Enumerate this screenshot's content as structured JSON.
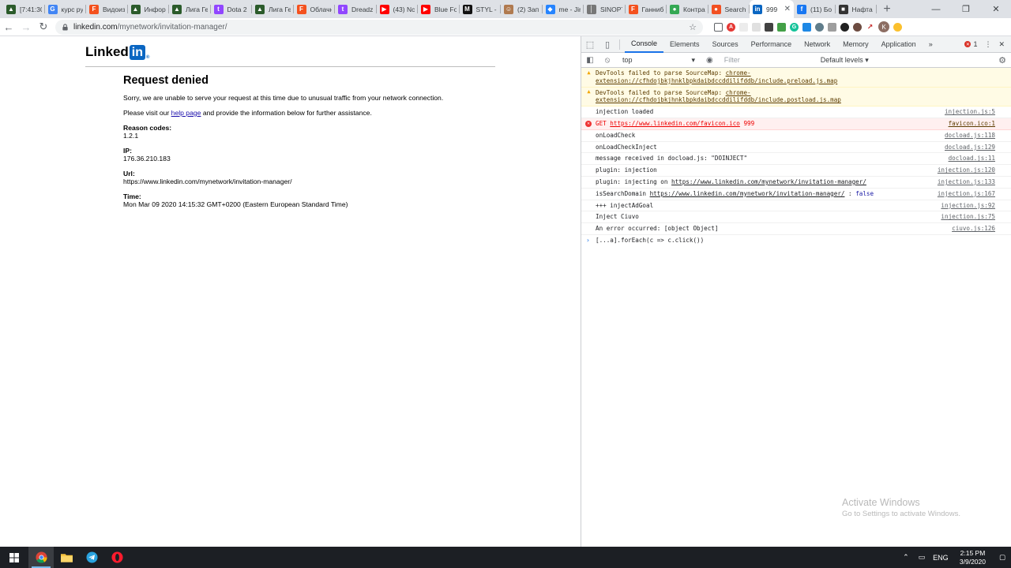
{
  "browser": {
    "tabs": [
      {
        "title": "[7:41:30",
        "color": "#2b5b2b",
        "glyph": "▲"
      },
      {
        "title": "курс руб",
        "color": "#4285f4",
        "glyph": "G"
      },
      {
        "title": "Видоиз",
        "color": "#f4511e",
        "glyph": "F"
      },
      {
        "title": "Инфор",
        "color": "#2b5b2b",
        "glyph": "▲"
      },
      {
        "title": "Лига Ге",
        "color": "#2b5b2b",
        "glyph": "▲"
      },
      {
        "title": "Dota 2",
        "color": "#9146ff",
        "glyph": "t"
      },
      {
        "title": "Лига Ге",
        "color": "#2b5b2b",
        "glyph": "▲"
      },
      {
        "title": "Облачн",
        "color": "#f4511e",
        "glyph": "F"
      },
      {
        "title": "Dreadz",
        "color": "#9146ff",
        "glyph": "t"
      },
      {
        "title": "(43) Nc",
        "color": "#ff0000",
        "glyph": "▶"
      },
      {
        "title": "Blue Fo",
        "color": "#ff0000",
        "glyph": "▶"
      },
      {
        "title": "STYL -",
        "color": "#111111",
        "glyph": "M"
      },
      {
        "title": "(2) Зап",
        "color": "#b07a4f",
        "glyph": "☺"
      },
      {
        "title": "me - Jir",
        "color": "#2684ff",
        "glyph": "◆"
      },
      {
        "title": "SINOPT",
        "color": "#777777",
        "glyph": "│"
      },
      {
        "title": "Ганниб",
        "color": "#f4511e",
        "glyph": "F"
      },
      {
        "title": "Контра",
        "color": "#34a853",
        "glyph": "●"
      },
      {
        "title": "Search",
        "color": "#f25022",
        "glyph": "●"
      },
      {
        "title": "999",
        "color": "#0a66c2",
        "glyph": "in"
      },
      {
        "title": "(11) Бо",
        "color": "#1877f2",
        "glyph": "f"
      },
      {
        "title": "Нафта",
        "color": "#333333",
        "glyph": "■"
      }
    ],
    "active_tab": 18,
    "tab_close": "✕",
    "new_tab": "+",
    "url_host": "linkedin.com",
    "url_path": "/mynetwork/invitation-manager/",
    "profile_initial": "K"
  },
  "page": {
    "logo_text": "Linked",
    "logo_in": "in",
    "logo_reg": "®",
    "heading": "Request denied",
    "p1": "Sorry, we are unable to serve your request at this time due to unusual traffic from your network connection.",
    "p2_before": "Please visit our ",
    "p2_link": "help page",
    "p2_after": " and provide the information below for further assistance.",
    "fields": [
      {
        "label": "Reason codes:",
        "value": "1.2.1"
      },
      {
        "label": "IP:",
        "value": "176.36.210.183"
      },
      {
        "label": "Url:",
        "value": "https://www.linkedin.com/mynetwork/invitation-manager/"
      },
      {
        "label": "Time:",
        "value": "Mon Mar 09 2020 14:15:32 GMT+0200 (Eastern European Standard Time)"
      }
    ]
  },
  "devtools": {
    "tabs": [
      "Console",
      "Elements",
      "Sources",
      "Performance",
      "Network",
      "Memory",
      "Application"
    ],
    "active_tab": "Console",
    "more": "»",
    "error_count": "1",
    "context": "top",
    "filter_placeholder": "Filter",
    "levels": "Default levels ▾",
    "messages": [
      {
        "type": "warn",
        "text": "DevTools failed to parse SourceMap: ",
        "link": "chrome-extension://cfhdojbkjhnklbpkdaibdccddilifddb/include.preload.js.map",
        "src": ""
      },
      {
        "type": "warn",
        "text": "DevTools failed to parse SourceMap: ",
        "link": "chrome-extension://cfhdojbkjhnklbpkdaibdccddilifddb/include.postload.js.map",
        "src": ""
      },
      {
        "type": "log",
        "text": "injection loaded",
        "link": "",
        "src": "injection.js:5"
      },
      {
        "type": "err",
        "text": "GET ",
        "link": "https://www.linkedin.com/favicon.ico",
        "after": " 999",
        "src": "favicon.ico:1"
      },
      {
        "type": "log",
        "text": "onLoadCheck",
        "link": "",
        "src": "docload.js:118"
      },
      {
        "type": "log",
        "text": "onLoadCheckInject",
        "link": "",
        "src": "docload.js:129"
      },
      {
        "type": "log",
        "text": "message received in docload.js:  \"DOINJECT\"",
        "link": "",
        "src": "docload.js:11"
      },
      {
        "type": "log",
        "text": "plugin: injection",
        "link": "",
        "src": "injection.js:120"
      },
      {
        "type": "log",
        "text": "plugin: injecting on ",
        "link": "https://www.linkedin.com/mynetwork/invitation-manager/",
        "src": "injection.js:133"
      },
      {
        "type": "log",
        "text": "isSearchDomain  ",
        "link": "https://www.linkedin.com/mynetwork/invitation-manager/",
        "after": "  :  ",
        "kw": "false",
        "src": "injection.js:167"
      },
      {
        "type": "log",
        "text": "+++ injectAdGoal",
        "link": "",
        "src": "injection.js:92"
      },
      {
        "type": "log",
        "text": "Inject Ciuvo",
        "link": "",
        "src": "injection.js:75"
      },
      {
        "type": "log",
        "text": "An error occurred: [object Object]",
        "link": "",
        "src": "ciuvo.js:126"
      }
    ],
    "prompt": "[...a].forEach(c => c.click())"
  },
  "watermark": {
    "line1": "Activate Windows",
    "line2": "Go to Settings to activate Windows."
  },
  "taskbar": {
    "lang": "ENG",
    "time": "2:15 PM",
    "date": "3/9/2020"
  }
}
